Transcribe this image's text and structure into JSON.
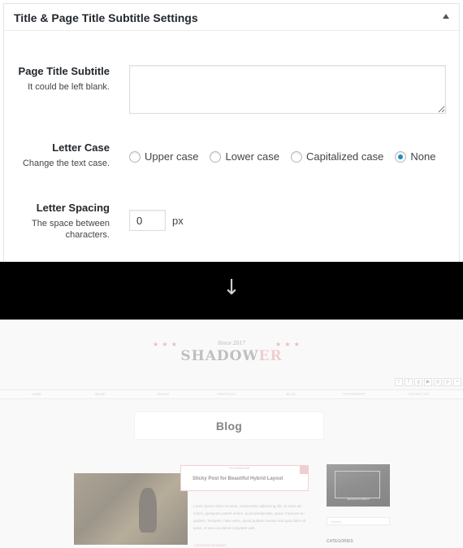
{
  "panel": {
    "title": "Title & Page Title Subtitle Settings",
    "toggle_icon": "triangle-up-icon"
  },
  "subtitle": {
    "label": "Page Title Subtitle",
    "desc": "It could be left blank.",
    "value": ""
  },
  "letter_case": {
    "label": "Letter Case",
    "desc": "Change the text case.",
    "options": [
      "Upper case",
      "Lower case",
      "Capitalized case",
      "None"
    ],
    "selected": "None"
  },
  "letter_spacing": {
    "label": "Letter Spacing",
    "desc_line1": "The space between",
    "desc_line2": "characters.",
    "value": "0",
    "unit": "px"
  },
  "separator": {
    "arrow": "↓"
  },
  "preview": {
    "logo_tagline": "Since 2017",
    "logo_main": "SHADOW",
    "logo_accent": "ER",
    "stars": "★ ★ ★",
    "nav": [
      "HOME",
      "IMAGE",
      "SINGLE",
      "PORTFOLIO",
      "BLOG",
      "TYPOGRAPHY",
      "CONTACT US"
    ],
    "social_icons": [
      "twitter-icon",
      "facebook-icon",
      "google-plus-icon",
      "youtube-icon",
      "instagram-icon",
      "pinterest-icon",
      "rss-icon"
    ],
    "blog_title": "Blog",
    "post_category": "AN ENNIGMA",
    "post_title": "Sticky Post for Beautiful Hybrid Layout",
    "post_excerpt": "Lorem ipsum dolor sit amet, consectetur adipiscing elit. Ut enim ad minim, quisquam potest dolore, quod perspiciatis, quasi. Facenes su quidem, Torquate, haec enim. Quod quidem fuerant sed quia dolor sit amet. At vos cos dolore voluptate velit.",
    "post_more": "CONTINUE READING",
    "side_caption": "ADVENTURES",
    "side_search": "Search...",
    "side_categories": "CATEGORIES"
  }
}
